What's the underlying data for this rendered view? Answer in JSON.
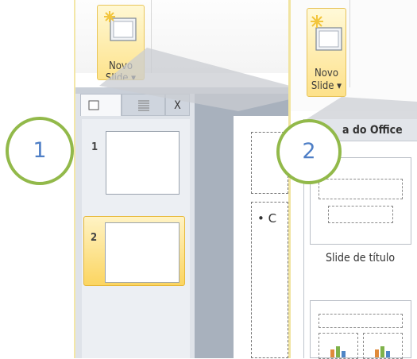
{
  "left_view": {
    "ribbon": {
      "new_slide_line1": "Novo",
      "new_slide_line2": "Slide ▾"
    },
    "pane_tabs": {
      "close_label": "X"
    },
    "slides": [
      {
        "number": "1"
      },
      {
        "number": "2"
      }
    ],
    "bullet_text": "• C",
    "step_label": "1"
  },
  "right_view": {
    "ribbon": {
      "new_slide_line1": "Novo",
      "new_slide_line2": "Slide ▾"
    },
    "gallery_header": "a do Office",
    "layout_caption": "Slide de título",
    "step_label": "2"
  },
  "colors": {
    "selection": "#fbd561",
    "callout_ring": "#92b94a",
    "callout_digit": "#4f7fc6"
  }
}
